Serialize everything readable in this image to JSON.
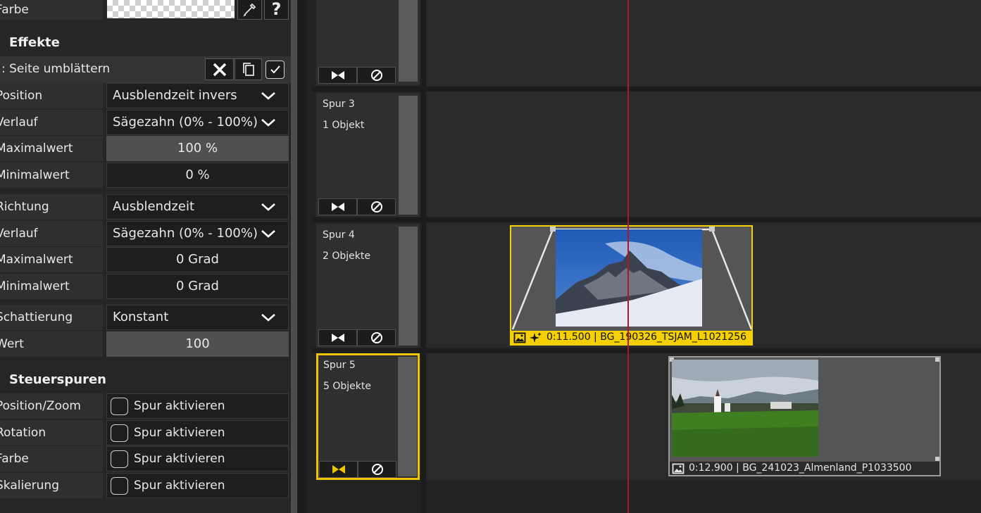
{
  "left_panel": {
    "color_label": "Farbe",
    "effects_heading": "Effekte",
    "effect_title": ": Seite umblättern",
    "rows1": [
      {
        "label": "Position",
        "value": "Ausblendzeit invers",
        "kind": "select"
      },
      {
        "label": "Verlauf",
        "value": "Sägezahn (0% - 100%)",
        "kind": "select"
      },
      {
        "label": "Maximalwert",
        "value": "100 %",
        "kind": "number-hl"
      },
      {
        "label": "Minimalwert",
        "value": "0 %",
        "kind": "number"
      }
    ],
    "rows2": [
      {
        "label": "Richtung",
        "value": "Ausblendzeit",
        "kind": "select"
      },
      {
        "label": "Verlauf",
        "value": "Sägezahn (0% - 100%)",
        "kind": "select"
      },
      {
        "label": "Maximalwert",
        "value": "0 Grad",
        "kind": "number"
      },
      {
        "label": "Minimalwert",
        "value": "0 Grad",
        "kind": "number"
      }
    ],
    "rows3": [
      {
        "label": "Schattierung",
        "value": "Konstant",
        "kind": "select"
      },
      {
        "label": "Wert",
        "value": "100",
        "kind": "number-hl"
      }
    ],
    "control_heading": "Steuerspuren",
    "control_rows": [
      {
        "label": "Position/Zoom",
        "value": "Spur aktivieren"
      },
      {
        "label": "Rotation",
        "value": "Spur aktivieren"
      },
      {
        "label": "Farbe",
        "value": "Spur aktivieren"
      },
      {
        "label": "Skalierung",
        "value": "Spur aktivieren"
      }
    ]
  },
  "tracks": [
    {
      "name": "",
      "count": ""
    },
    {
      "name": "Spur 3",
      "count": "1 Objekt"
    },
    {
      "name": "Spur 4",
      "count": "2 Objekte"
    },
    {
      "name": "Spur 5",
      "count": "5 Objekte"
    }
  ],
  "clips": [
    {
      "label": "0:11.500 | BG_190326_TSJAM_L1021256",
      "highlight_color": "#f5d000"
    },
    {
      "label": "0:12.900 | BG_241023_Almenland_P1033500"
    }
  ],
  "colors": {
    "accent": "#f0c400",
    "playhead": "#b3161e"
  }
}
